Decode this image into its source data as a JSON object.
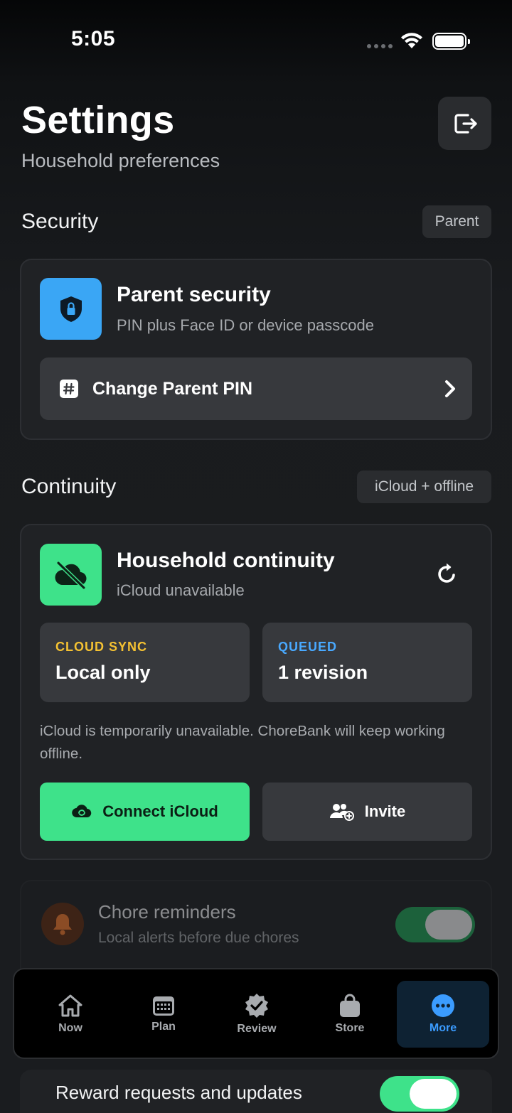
{
  "status_bar": {
    "time": "5:05"
  },
  "header": {
    "title": "Settings",
    "subtitle": "Household preferences"
  },
  "security": {
    "section_title": "Security",
    "badge": "Parent",
    "card_title": "Parent security",
    "card_subtitle": "PIN plus Face ID or device passcode",
    "change_pin_label": "Change Parent PIN",
    "icon_color": "#3aa6f5"
  },
  "continuity": {
    "section_title": "Continuity",
    "badge": "iCloud + offline",
    "card_title": "Household continuity",
    "card_subtitle": "iCloud unavailable",
    "icon_color": "#3ee28a",
    "stats": [
      {
        "label": "CLOUD SYNC",
        "value": "Local only",
        "label_color": "#f5c232"
      },
      {
        "label": "QUEUED",
        "value": "1 revision",
        "label_color": "#49a9ff"
      }
    ],
    "note": "iCloud is temporarily unavailable. ChoreBank will keep working offline.",
    "connect_label": "Connect iCloud",
    "invite_label": "Invite"
  },
  "reminders": {
    "title": "Chore reminders",
    "subtitle": "Local alerts before due chores",
    "enabled": true
  },
  "reward_requests": {
    "title": "Reward requests and updates",
    "enabled": true
  },
  "tabs": [
    {
      "label": "Now",
      "icon": "house-icon",
      "active": false
    },
    {
      "label": "Plan",
      "icon": "calendar-icon",
      "active": false
    },
    {
      "label": "Review",
      "icon": "checkmark-seal-icon",
      "active": false
    },
    {
      "label": "Store",
      "icon": "bag-icon",
      "active": false
    },
    {
      "label": "More",
      "icon": "ellipsis-circle-icon",
      "active": true
    }
  ],
  "colors": {
    "accent": "#3b9cff",
    "green": "#3ee28a",
    "background": "#1a1c1f",
    "card": "#202225"
  }
}
